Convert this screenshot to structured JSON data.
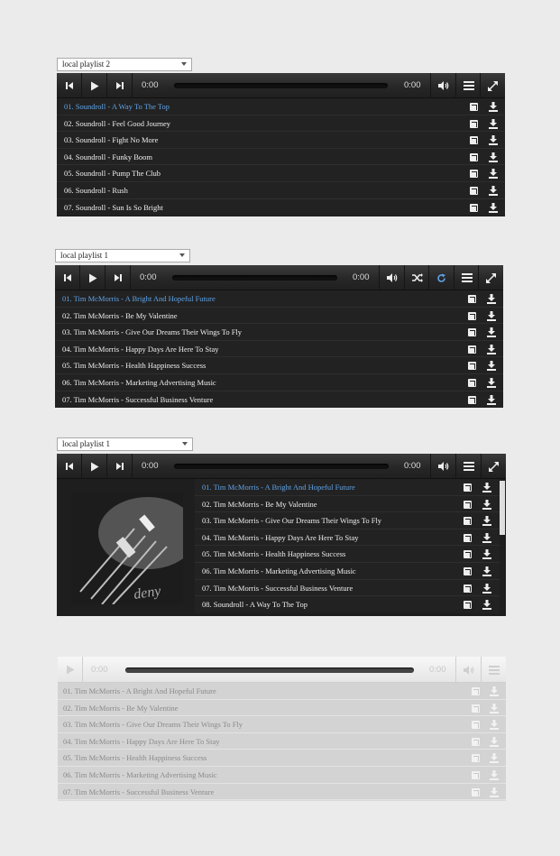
{
  "icons": {
    "prev": "skip-back-icon",
    "play": "play-icon",
    "next": "skip-forward-icon",
    "volume": "volume-icon",
    "playlist": "playlist-icon",
    "fullscreen": "fullscreen-icon",
    "shuffle": "shuffle-icon",
    "repeat": "repeat-icon",
    "external": "external-link-icon",
    "download": "download-icon"
  },
  "colors": {
    "active_track": "#5fa3e6",
    "repeat_active": "#5fa3e6"
  },
  "player1": {
    "playlist_select": "local playlist 2",
    "current_time": "0:00",
    "duration": "0:00",
    "tracks": [
      "01. Soundroll - A Way To The Top",
      "02. Soundroll - Feel Good Journey",
      "03. Soundroll - Fight No More",
      "04. Soundroll - Funky Boom",
      "05. Soundroll - Pump The Club",
      "06. Soundroll - Rush",
      "07. Soundroll - Sun Is So Bright"
    ]
  },
  "player2": {
    "playlist_select": "local playlist 1",
    "current_time": "0:00",
    "duration": "0:00",
    "tracks": [
      "01. Tim McMorris - A Bright And Hopeful Future",
      "02. Tim McMorris - Be My Valentine",
      "03. Tim McMorris - Give Our Dreams Their Wings To Fly",
      "04. Tim McMorris - Happy Days Are Here To Stay",
      "05. Tim McMorris - Health Happiness Success",
      "06. Tim McMorris - Marketing Advertising Music",
      "07. Tim McMorris - Successful Business Venture"
    ]
  },
  "player3": {
    "playlist_select": "local playlist 1",
    "current_time": "0:00",
    "duration": "0:00",
    "cover_text": "deny",
    "tracks": [
      "01. Tim McMorris - A Bright And Hopeful Future",
      "02. Tim McMorris - Be My Valentine",
      "03. Tim McMorris - Give Our Dreams Their Wings To Fly",
      "04. Tim McMorris - Happy Days Are Here To Stay",
      "05. Tim McMorris - Health Happiness Success",
      "06. Tim McMorris - Marketing Advertising Music",
      "07. Tim McMorris - Successful Business Venture",
      "08. Soundroll - A Way To The Top"
    ]
  },
  "player4": {
    "current_time": "0:00",
    "duration": "0:00",
    "tracks": [
      "01. Tim McMorris - A Bright And Hopeful Future",
      "02. Tim McMorris - Be My Valentine",
      "03. Tim McMorris - Give Our Dreams Their Wings To Fly",
      "04. Tim McMorris - Happy Days Are Here To Stay",
      "05. Tim McMorris - Health Happiness Success",
      "06. Tim McMorris - Marketing Advertising Music",
      "07. Tim McMorris - Successful Business Venture"
    ]
  }
}
